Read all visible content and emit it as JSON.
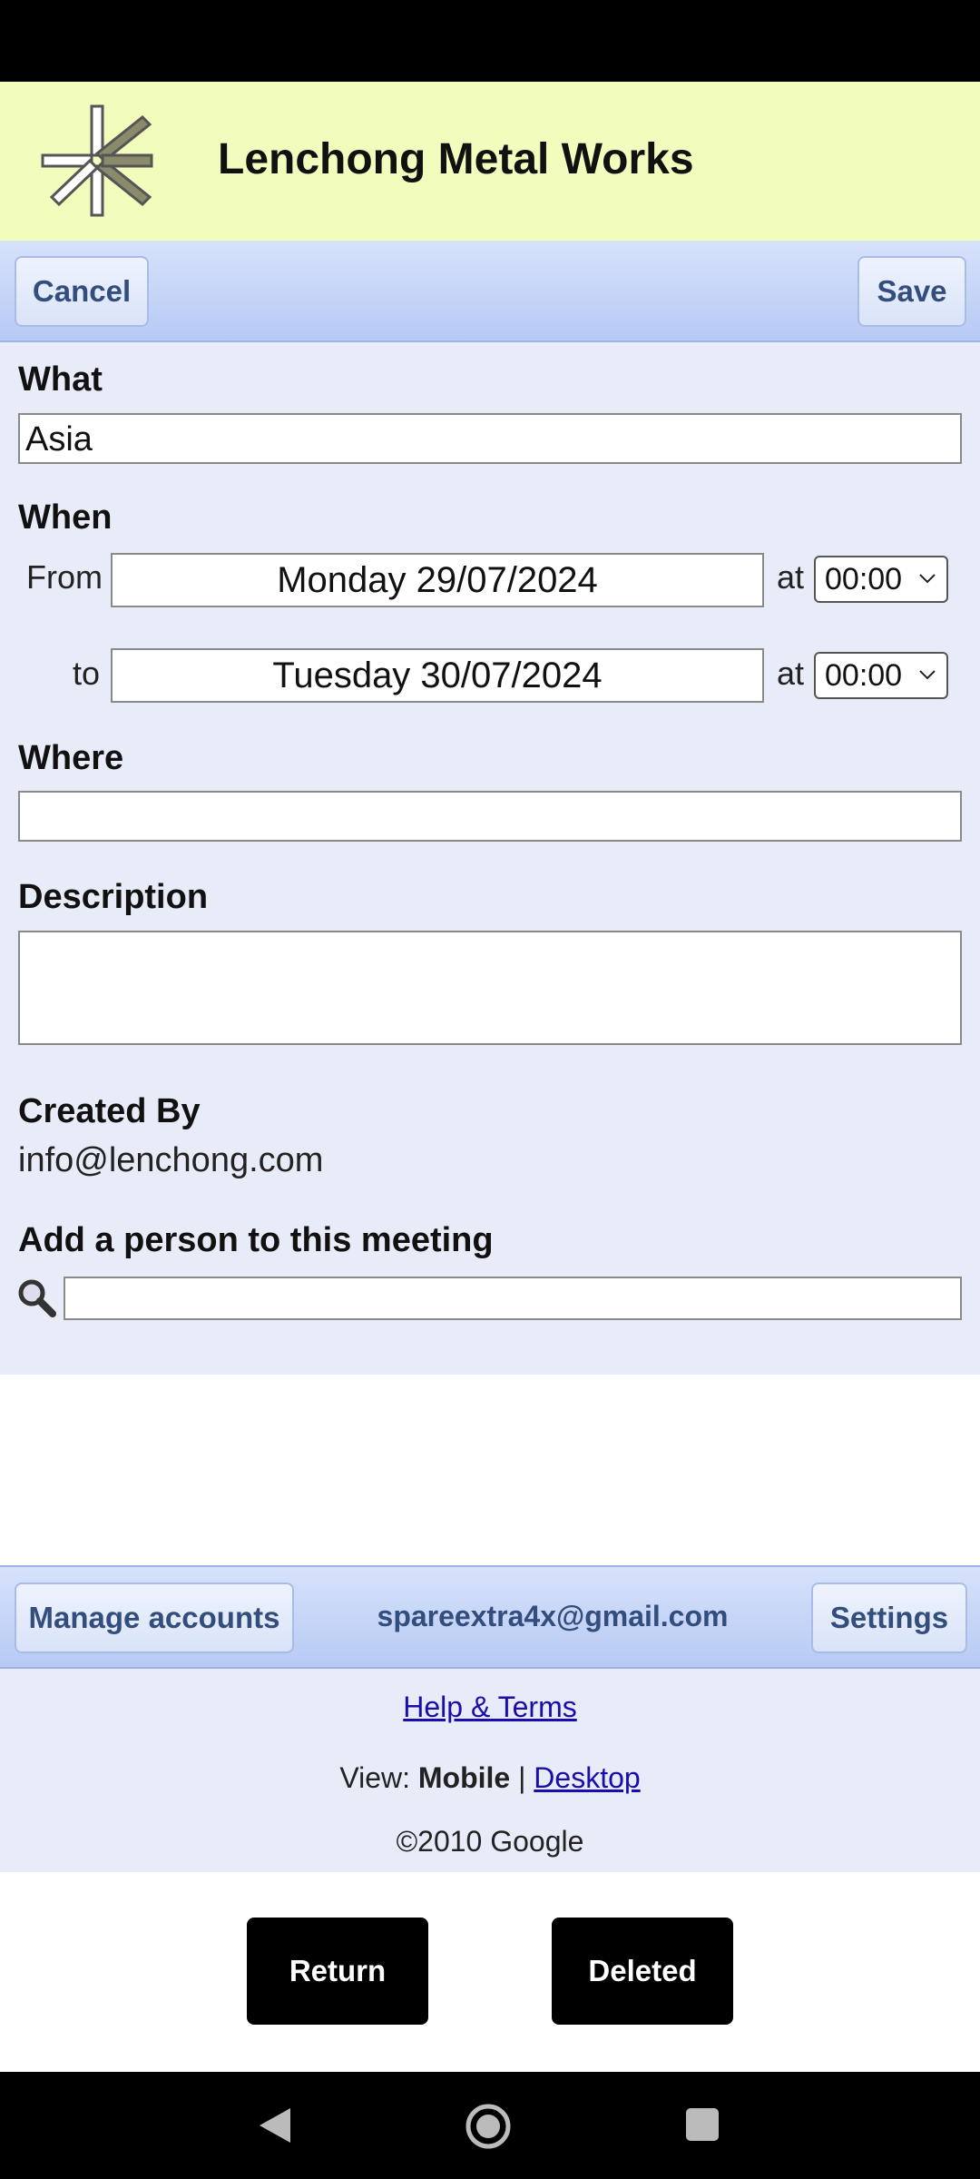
{
  "header": {
    "title": "Lenchong Metal Works"
  },
  "toolbar": {
    "cancel_label": "Cancel",
    "save_label": "Save"
  },
  "form": {
    "what_label": "What",
    "what_value": "Asia",
    "when_label": "When",
    "from_label": "From",
    "from_date": "Monday 29/07/2024",
    "at_label": "at",
    "from_time": "00:00",
    "to_label": "to",
    "to_date": "Tuesday 30/07/2024",
    "to_time": "00:00",
    "where_label": "Where",
    "where_value": "",
    "description_label": "Description",
    "description_value": "",
    "created_by_label": "Created By",
    "created_by_value": "info@lenchong.com",
    "add_person_label": "Add a person to this meeting",
    "add_person_value": ""
  },
  "footer_toolbar": {
    "manage_accounts_label": "Manage accounts",
    "account_email": "spareextra4x@gmail.com",
    "settings_label": "Settings"
  },
  "footer": {
    "help_terms": "Help & Terms",
    "view_prefix": "View:",
    "view_mobile": "Mobile",
    "view_separator": "|",
    "view_desktop": "Desktop",
    "copyright": "©2010 Google"
  },
  "actions": {
    "return_label": "Return",
    "deleted_label": "Deleted"
  },
  "icons": {
    "logo": "star-logo-icon",
    "search": "search-icon",
    "time_dropdown": "chevron-down-icon",
    "nav_back": "back-icon",
    "nav_home": "home-icon",
    "nav_recents": "recents-icon"
  },
  "colors": {
    "header_bg": "#f2fcbd",
    "toolbar_bg": "#c6d6f7",
    "form_bg": "#e8ecf8",
    "button_text": "#334d7d",
    "link": "#1a0dab"
  }
}
